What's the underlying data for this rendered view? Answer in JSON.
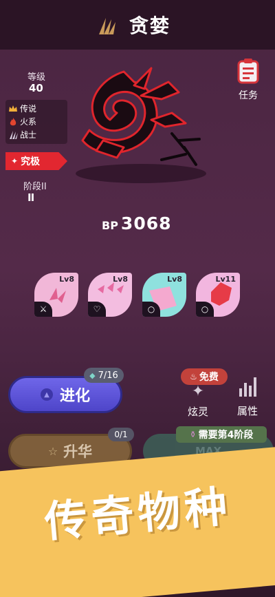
{
  "header": {
    "title": "贪婪",
    "icon": "claw-mark-icon"
  },
  "info": {
    "level_label": "等级",
    "level_value": "40",
    "tags": [
      {
        "label": "传说",
        "icon": "crown-icon"
      },
      {
        "label": "火系",
        "icon": "fire-icon"
      },
      {
        "label": "战士",
        "icon": "claw-icon"
      }
    ],
    "rarity_badge": "究极",
    "stage_label": "阶段II",
    "stage_roman": "II"
  },
  "task": {
    "label": "任务",
    "icon": "clipboard-icon"
  },
  "bp": {
    "label": "BP",
    "value": "3068"
  },
  "cards": [
    {
      "level": "Lv8",
      "icon": "claw-icon",
      "color": "#f1b7d8"
    },
    {
      "level": "Lv8",
      "icon": "amulet-icon",
      "color": "#f3bde0"
    },
    {
      "level": "Lv8",
      "icon": "ring-icon",
      "color": "#8fe1de"
    },
    {
      "level": "Lv11",
      "icon": "ring-icon",
      "color": "#f2b6df"
    }
  ],
  "actions": {
    "evolve_label": "进化",
    "evolve_count": "7/16",
    "free_badge": "免费",
    "spirit_label": "炫灵",
    "attr_label": "属性",
    "ascend_label": "升华",
    "ascend_count": "0/1",
    "max_label": "MAX",
    "need_stage": "需要第4阶段"
  },
  "banner": {
    "text": "传奇物种",
    "color": "#f6c35d"
  }
}
